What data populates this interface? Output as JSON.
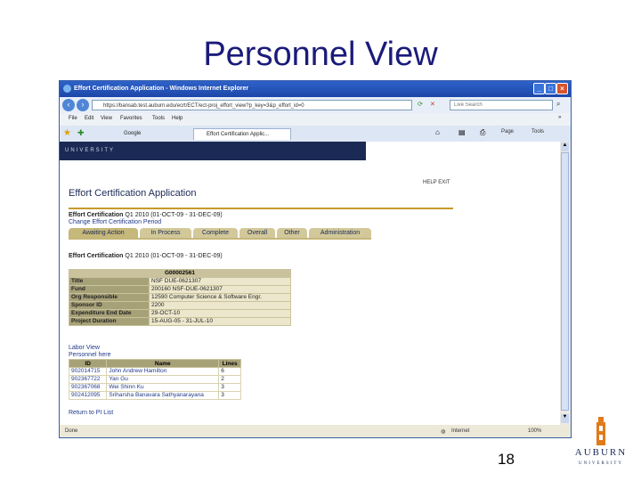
{
  "slide": {
    "title": "Personnel View",
    "page_number": "18"
  },
  "logo": {
    "word": "AUBURN",
    "sub": "UNIVERSITY"
  },
  "browser": {
    "window_title": "Effort Certification Application - Windows Internet Explorer",
    "address": "https://bansab.test.auburn.edu/ecrt/ECT/ect-proj_effort_view?p_key=3&p_effort_id=0",
    "search_placeholder": "Live Search",
    "menu": [
      "File",
      "Edit",
      "View",
      "Favorites",
      "Tools",
      "Help"
    ],
    "tabs": [
      "Google",
      "Effort Certification Applic..."
    ],
    "tools": [
      "Page",
      "Tools"
    ],
    "status_left": "Done",
    "status_zone": "Internet",
    "status_zoom": "100%"
  },
  "page": {
    "banner": "UNIVERSITY",
    "help_exit": "HELP  EXIT",
    "app_title": "Effort Certification Application",
    "cert_label": "Effort Certification",
    "cert_value": "Q1 2010 (01-OCT-09 - 31-DEC-09)",
    "change_link": "Change Effort Certification Period",
    "tabs": [
      "Awaiting Action",
      "In Process",
      "Complete",
      "Overall",
      "Other",
      "Administration"
    ],
    "cert_heading_label": "Effort Certification",
    "cert_heading_value": "Q1 2010 (01-OCT-09 - 31-DEC-09)",
    "grant_id": "G00002561",
    "details": [
      {
        "key": "Title",
        "value": "NSF DUE-0621307"
      },
      {
        "key": "Fund",
        "value": "200160 NSF-DUE-0621307"
      },
      {
        "key": "Org Responsible",
        "value": "12590 Computer Science & Software Engr."
      },
      {
        "key": "Sponsor ID",
        "value": "2200"
      },
      {
        "key": "Expenditure End Date",
        "value": "29-OCT-10"
      },
      {
        "key": "Project Duration",
        "value": "15-AUG-05 - 31-JUL-10"
      }
    ],
    "labor_link": "Labor View",
    "personnel_link": "Personnel here",
    "people_headers": [
      "ID",
      "Name",
      "Lines"
    ],
    "people": [
      {
        "id": "902014715",
        "name": "John Andrew Hamilton",
        "lines": "6"
      },
      {
        "id": "902367722",
        "name": "Yan Gu",
        "lines": "2"
      },
      {
        "id": "902367068",
        "name": "Wei Shinn Ku",
        "lines": "3"
      },
      {
        "id": "902412095",
        "name": "Sriharsha Banavara Sathyanarayana",
        "lines": "3"
      }
    ],
    "return_link": "Return to PI List"
  }
}
